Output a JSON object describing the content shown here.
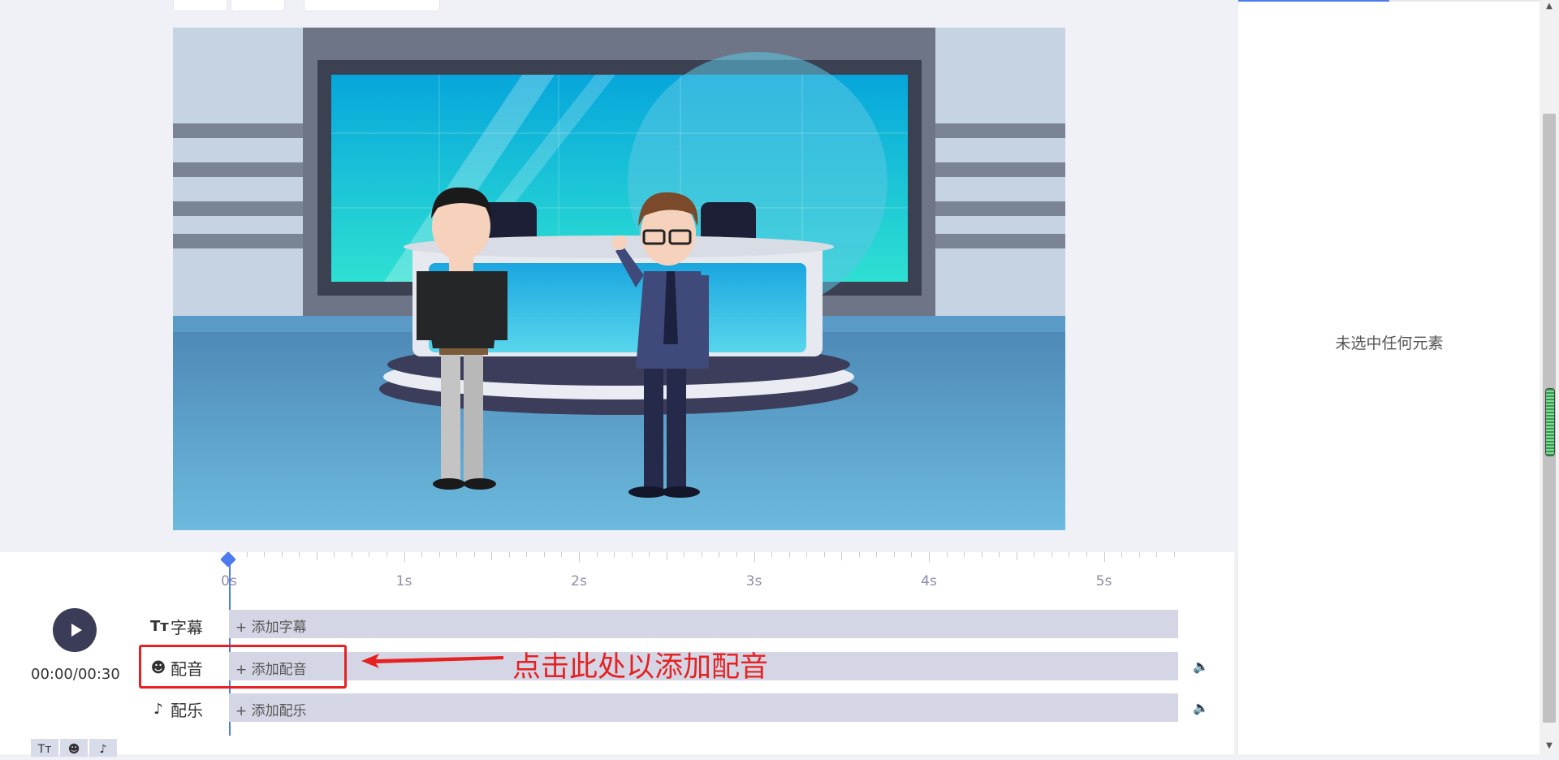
{
  "right_panel": {
    "empty_text": "未选中任何元素"
  },
  "ruler": {
    "labels": [
      "0s",
      "1s",
      "2s",
      "3s",
      "4s",
      "5s"
    ]
  },
  "player": {
    "current_time": "00:00",
    "total_time": "00:30",
    "separator": "/"
  },
  "tracks": [
    {
      "icon": "text-size-icon",
      "label": "字幕",
      "add_label": "+ 添加字幕",
      "volume": false
    },
    {
      "icon": "face-icon",
      "label": "配音",
      "add_label": "+ 添加配音",
      "volume": true
    },
    {
      "icon": "music-note-icon",
      "label": "配乐",
      "add_label": "+ 添加配乐",
      "volume": true
    }
  ],
  "annotation": {
    "text": "点击此处以添加配音",
    "color": "#e62121"
  },
  "colors": {
    "accent": "#4c7bf0",
    "track": "#d5d6e5",
    "play_button": "#3b3d58"
  }
}
